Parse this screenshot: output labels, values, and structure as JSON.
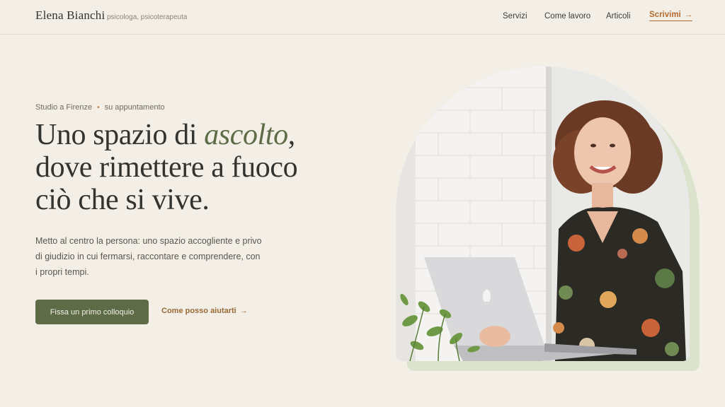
{
  "header": {
    "brand_name": "Elena Bianchi",
    "brand_subtitle": "psicologa, psicoterapeuta",
    "nav": [
      "Servizi",
      "Come lavoro",
      "Articoli"
    ],
    "cta_label": "Scrivimi",
    "cta_arrow": "→"
  },
  "hero": {
    "eyebrow_location": "Studio a Firenze",
    "eyebrow_dot": "•",
    "eyebrow_note": "su appuntamento",
    "headline_part1": "Uno spazio di ",
    "headline_accent": "ascolto",
    "headline_part2": ",",
    "headline_line2": "dove rimettere a fuoco",
    "headline_line3": "ciò che si vive.",
    "lead": "Metto al centro la persona: uno spazio accogliente e privo di giudizio in cui fermarsi, raccontare e comprendere, con i propri tempi.",
    "primary_button": "Fissa un primo colloquio",
    "secondary_link": "Come posso aiutarti",
    "secondary_arrow": "→"
  },
  "colors": {
    "background": "#f3efe7",
    "accent_green": "#5d6b47",
    "accent_copper": "#b36a2e",
    "photo_shadow": "#dce3cd"
  },
  "icons": {
    "cta_arrow": "arrow-right-icon",
    "link_arrow": "arrow-right-icon"
  }
}
